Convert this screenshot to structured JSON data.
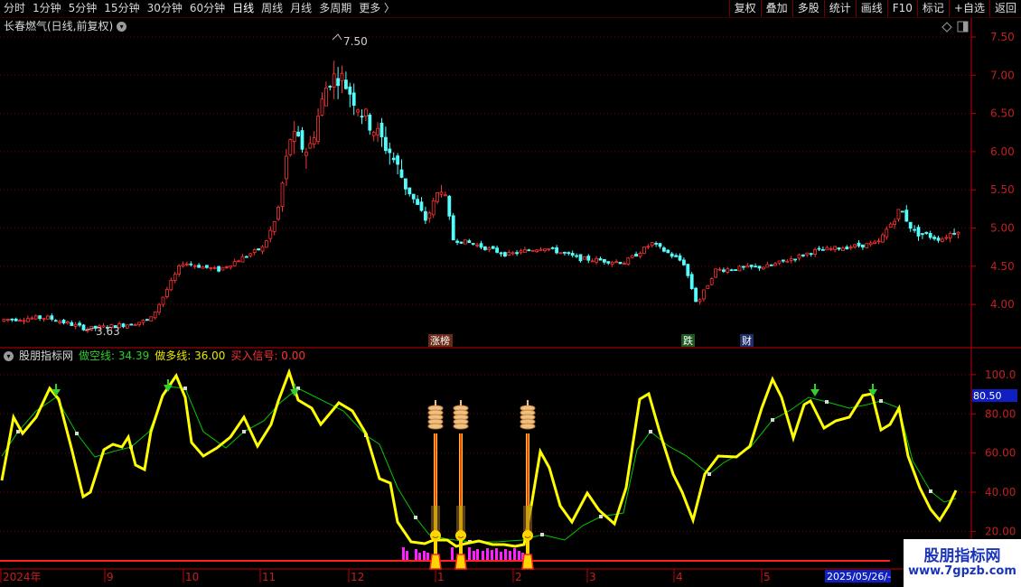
{
  "toolbar": {
    "periods": [
      "分时",
      "1分钟",
      "5分钟",
      "15分钟",
      "30分钟",
      "60分钟",
      "日线",
      "周线",
      "月线",
      "多周期",
      "更多 〉"
    ],
    "active_index": 6,
    "buttons": [
      "复权",
      "叠加",
      "多股",
      "统计",
      "画线",
      "F10",
      "标记",
      "+自选",
      "返回"
    ]
  },
  "main_panel": {
    "title": "长春燃气(日线,前复权)",
    "price_axis": [
      "7.50",
      "7.00",
      "6.50",
      "6.00",
      "5.50",
      "5.00",
      "4.50",
      "4.00"
    ],
    "high_label": "7.50",
    "low_label": "3.63",
    "markers": [
      "涨榜",
      "跌",
      "财"
    ]
  },
  "indicator": {
    "name": "股朋指标网",
    "short_line_label": "做空线: 34.39",
    "long_line_label": "做多线: 36.00",
    "signal_label": "买入信号: 0.00",
    "axis": [
      "100.0",
      "80.00",
      "60.00",
      "40.00",
      "20.00"
    ],
    "current_value": "80.50"
  },
  "date_axis": {
    "labels": [
      "2024年",
      "9",
      "10",
      "11",
      "12",
      "1",
      "2",
      "3",
      "4",
      "5"
    ],
    "current_date": "2025/05/26/-"
  },
  "watermark": {
    "name": "股朋指标网",
    "url": "www.7gpzb.com"
  },
  "colors": {
    "up": "#ff3232",
    "down": "#54fcfc",
    "fast_line": "#ffff00",
    "slow_line": "#00c800",
    "axis": "#c00000"
  }
}
